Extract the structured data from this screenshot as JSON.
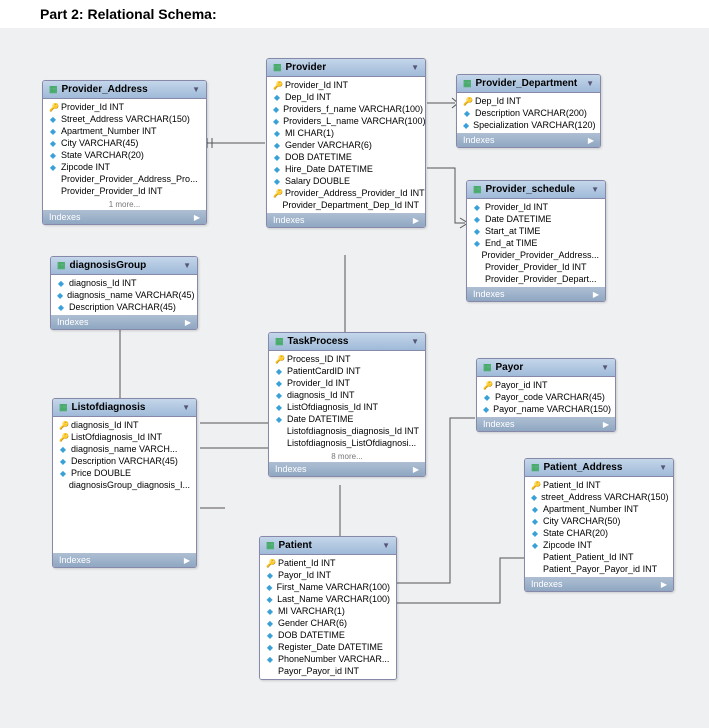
{
  "title": "Part 2: Relational Schema:",
  "indexes_label": "Indexes",
  "more1": "1 more...",
  "more8": "8 more...",
  "tables": {
    "provider_address": {
      "name": "Provider_Address",
      "cols": [
        {
          "icon": "k",
          "text": "Provider_Id INT"
        },
        {
          "icon": "d",
          "text": "Street_Address VARCHAR(150)"
        },
        {
          "icon": "d",
          "text": "Apartment_Number INT"
        },
        {
          "icon": "d",
          "text": "City VARCHAR(45)"
        },
        {
          "icon": "d",
          "text": "State VARCHAR(20)"
        },
        {
          "icon": "d",
          "text": "Zipcode INT"
        },
        {
          "icon": "n",
          "text": "Provider_Provider_Address_Pro..."
        },
        {
          "icon": "n",
          "text": "Provider_Provider_Id INT"
        }
      ]
    },
    "provider": {
      "name": "Provider",
      "cols": [
        {
          "icon": "k",
          "text": "Provider_Id INT"
        },
        {
          "icon": "d",
          "text": "Dep_Id INT"
        },
        {
          "icon": "d",
          "text": "Providers_f_name VARCHAR(100)"
        },
        {
          "icon": "d",
          "text": "Providers_L_name VARCHAR(100)"
        },
        {
          "icon": "d",
          "text": "MI CHAR(1)"
        },
        {
          "icon": "d",
          "text": "Gender VARCHAR(6)"
        },
        {
          "icon": "d",
          "text": "DOB DATETIME"
        },
        {
          "icon": "d",
          "text": "Hire_Date DATETIME"
        },
        {
          "icon": "d",
          "text": "Salary DOUBLE"
        },
        {
          "icon": "k",
          "text": "Provider_Address_Provider_Id INT"
        },
        {
          "icon": "n",
          "text": "Provider_Department_Dep_Id INT"
        }
      ]
    },
    "provider_department": {
      "name": "Provider_Department",
      "cols": [
        {
          "icon": "k",
          "text": "Dep_Id INT"
        },
        {
          "icon": "d",
          "text": "Description VARCHAR(200)"
        },
        {
          "icon": "d",
          "text": "Specialization VARCHAR(120)"
        }
      ]
    },
    "provider_schedule": {
      "name": "Provider_schedule",
      "cols": [
        {
          "icon": "d",
          "text": "Provider_Id INT"
        },
        {
          "icon": "d",
          "text": "Date DATETIME"
        },
        {
          "icon": "d",
          "text": "Start_at TIME"
        },
        {
          "icon": "d",
          "text": "End_at TIME"
        },
        {
          "icon": "n",
          "text": "Provider_Provider_Address..."
        },
        {
          "icon": "n",
          "text": "Provider_Provider_Id INT"
        },
        {
          "icon": "n",
          "text": "Provider_Provider_Depart..."
        }
      ]
    },
    "diagnosis_group": {
      "name": "diagnosisGroup",
      "cols": [
        {
          "icon": "d",
          "text": "diagnosis_Id INT"
        },
        {
          "icon": "d",
          "text": "diagnosis_name VARCHAR(45)"
        },
        {
          "icon": "d",
          "text": "Description VARCHAR(45)"
        }
      ]
    },
    "task_process": {
      "name": "TaskProcess",
      "cols": [
        {
          "icon": "k",
          "text": "Process_ID INT"
        },
        {
          "icon": "d",
          "text": "PatientCardID INT"
        },
        {
          "icon": "d",
          "text": "Provider_Id INT"
        },
        {
          "icon": "d",
          "text": "diagnosis_Id INT"
        },
        {
          "icon": "d",
          "text": "ListOfdiagnosis_Id INT"
        },
        {
          "icon": "d",
          "text": "Date DATETIME"
        },
        {
          "icon": "n",
          "text": "Listofdiagnosis_diagnosis_Id INT"
        },
        {
          "icon": "n",
          "text": "Listofdiagnosis_ListOfdiagnosi..."
        }
      ]
    },
    "payor": {
      "name": "Payor",
      "cols": [
        {
          "icon": "k",
          "text": "Payor_id INT"
        },
        {
          "icon": "d",
          "text": "Payor_code VARCHAR(45)"
        },
        {
          "icon": "d",
          "text": "Payor_name VARCHAR(150)"
        }
      ]
    },
    "list_of_diagnosis": {
      "name": "Listofdiagnosis",
      "cols": [
        {
          "icon": "k",
          "text": "diagnosis_Id INT"
        },
        {
          "icon": "k",
          "text": "ListOfdiagnosis_Id INT"
        },
        {
          "icon": "d",
          "text": "diagnosis_name VARCH..."
        },
        {
          "icon": "d",
          "text": "Description VARCHAR(45)"
        },
        {
          "icon": "d",
          "text": "Price DOUBLE"
        },
        {
          "icon": "n",
          "text": "diagnosisGroup_diagnosis_I..."
        }
      ]
    },
    "patient_address": {
      "name": "Patient_Address",
      "cols": [
        {
          "icon": "k",
          "text": "Patient_Id INT"
        },
        {
          "icon": "d",
          "text": "street_Address VARCHAR(150)"
        },
        {
          "icon": "d",
          "text": "Apartment_Number INT"
        },
        {
          "icon": "d",
          "text": "City VARCHAR(50)"
        },
        {
          "icon": "d",
          "text": "State CHAR(20)"
        },
        {
          "icon": "d",
          "text": "Zipcode INT"
        },
        {
          "icon": "n",
          "text": "Patient_Patient_Id INT"
        },
        {
          "icon": "n",
          "text": "Patient_Payor_Payor_id INT"
        }
      ]
    },
    "patient": {
      "name": "Patient",
      "cols": [
        {
          "icon": "k",
          "text": "Patient_Id INT"
        },
        {
          "icon": "d",
          "text": "Payor_Id INT"
        },
        {
          "icon": "d",
          "text": "First_Name VARCHAR(100)"
        },
        {
          "icon": "d",
          "text": "Last_Name VARCHAR(100)"
        },
        {
          "icon": "d",
          "text": "MI VARCHAR(1)"
        },
        {
          "icon": "d",
          "text": "Gender CHAR(6)"
        },
        {
          "icon": "d",
          "text": "DOB DATETIME"
        },
        {
          "icon": "d",
          "text": "Register_Date DATETIME"
        },
        {
          "icon": "d",
          "text": "PhoneNumber VARCHAR..."
        },
        {
          "icon": "n",
          "text": "Payor_Payor_id INT"
        }
      ]
    }
  }
}
